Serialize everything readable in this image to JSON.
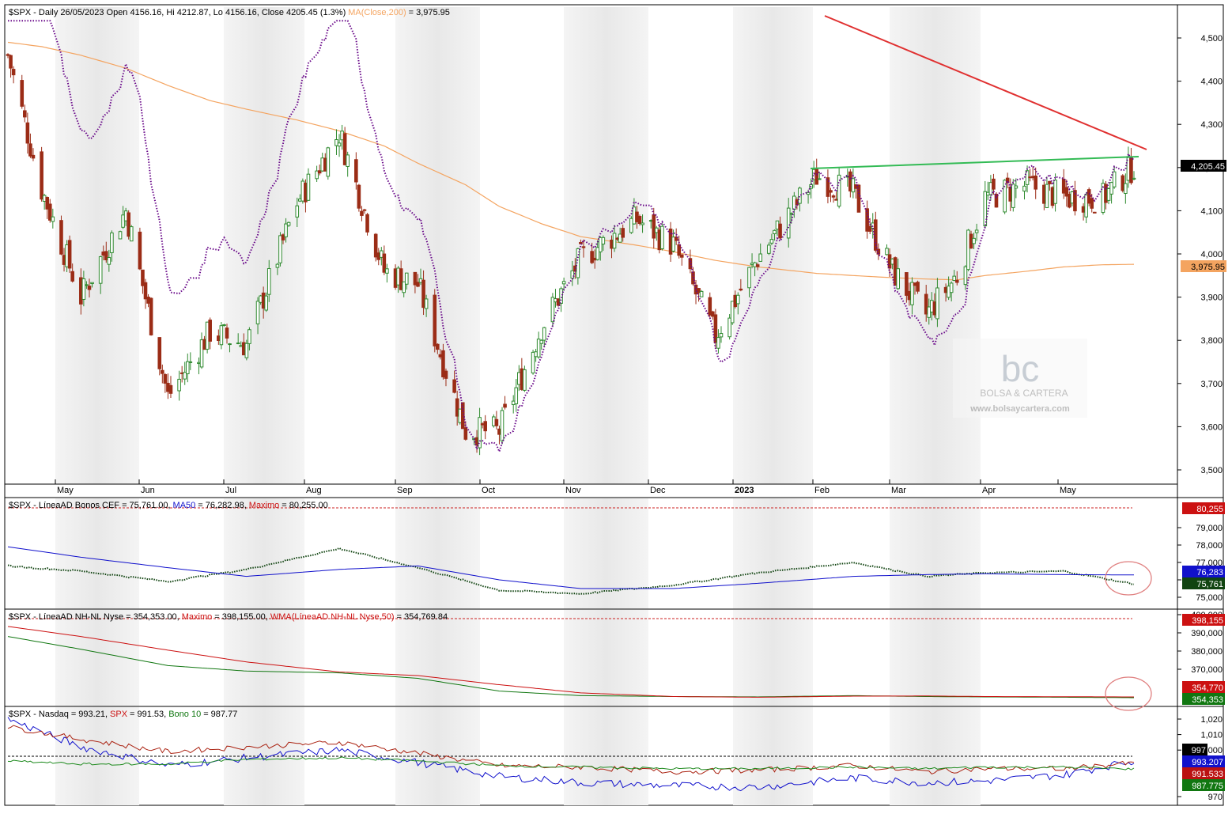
{
  "panel1": {
    "header": {
      "main": "$SPX - Daily 26/05/2023 Open 4156.16, Hi 4212.87, Lo 4156.16, Close 4205.45 (1.3%)",
      "ma_label": "MA(Close,200)",
      "ma_value": "= 3,975.95"
    },
    "y_ticks": [
      "4,500",
      "4,400",
      "4,300",
      "4,200",
      "4,100",
      "4,000",
      "3,900",
      "3,800",
      "3,700",
      "3,600",
      "3,500"
    ],
    "price_badge": "4,205.45",
    "ma_badge": "3,975.95",
    "watermark": {
      "brand": "BOLSA & CARTERA",
      "url": "www.bolsaycartera.com"
    }
  },
  "x_labels": [
    "May",
    "Jun",
    "Jul",
    "Aug",
    "Sep",
    "Oct",
    "Nov",
    "Dec",
    "2023",
    "Feb",
    "Mar",
    "Apr",
    "May"
  ],
  "panel2": {
    "header": {
      "main": "$SPX - LíneaAD Bonos CEF = 75,761.00,",
      "ma_label": "MA50",
      "ma_value": "= 76,282.98,",
      "max_label": "Maximo",
      "max_value": "= 80,255.00"
    },
    "y_ticks": [
      "79,000",
      "78,000",
      "77,000",
      "76,000",
      "75,000"
    ],
    "badges": {
      "max": "80,255",
      "ma": "76,283",
      "line": "75,761"
    }
  },
  "panel3": {
    "header": {
      "main": "$SPX - LíneaAD NH-NL Nyse = 354,353.00,",
      "max_label": "Maximo",
      "max_value": "= 398,155.00,",
      "wma_label": "WMA(LíneaAD NH-NL Nyse,50)",
      "wma_value": "= 354,769.84"
    },
    "y_ticks": [
      "400,000",
      "390,000",
      "380,000",
      "370,000"
    ],
    "badges": {
      "max": "398,155",
      "wma": "354,770",
      "line": "354,353"
    }
  },
  "panel4": {
    "header": {
      "main": "$SPX - Nasdaq",
      "nasdaq_value": "= 993.21,",
      "spx_label": "SPX",
      "spx_value": "= 991.53,",
      "bond_label": "Bono 10",
      "bond_value": "= 987.77"
    },
    "y_ticks": [
      "1,020",
      "1,010",
      "1,000",
      "970"
    ],
    "badges": {
      "ref": "997",
      "nasdaq": "993.207",
      "spx": "991.533",
      "bond": "987.775"
    }
  },
  "colors": {
    "up": "#2f8a2f",
    "down": "#9b2c16",
    "ma200": "#f4a460",
    "purple": "#6a0a8a",
    "resistance": "#e03030",
    "support": "#33bb55",
    "blue": "#1010cc",
    "green_line": "#1d7a1d",
    "red_line": "#cc1111",
    "dark_green": "#114411"
  },
  "chart_data": [
    {
      "type": "candlestick",
      "title": "$SPX - Daily 26/05/2023 Open 4156.16, Hi 4212.87, Lo 4156.16, Close 4205.45 (1.3%)",
      "x": [
        "2022-04-20",
        "2022-05-02",
        "2022-05-16",
        "2022-06-01",
        "2022-06-16",
        "2022-07-01",
        "2022-07-14",
        "2022-08-01",
        "2022-08-16",
        "2022-09-01",
        "2022-09-13",
        "2022-09-30",
        "2022-10-12",
        "2022-10-27",
        "2022-11-10",
        "2022-11-30",
        "2022-12-13",
        "2022-12-28",
        "2023-01-12",
        "2023-02-02",
        "2023-02-15",
        "2023-03-01",
        "2023-03-13",
        "2023-03-24",
        "2023-04-03",
        "2023-04-18",
        "2023-05-01",
        "2023-05-15",
        "2023-05-26"
      ],
      "close": [
        4460,
        4150,
        3900,
        4100,
        3670,
        3820,
        3790,
        4120,
        4280,
        3960,
        3930,
        3590,
        3590,
        3830,
        3990,
        4080,
        4020,
        3810,
        3990,
        4180,
        4140,
        3960,
        3860,
        3950,
        4130,
        4160,
        4130,
        4130,
        4205
      ],
      "ylim": [
        3480,
        4580
      ],
      "series": [
        {
          "name": "MA(Close,200)",
          "values": [
            4490,
            4480,
            4460,
            4430,
            4390,
            4355,
            4335,
            4310,
            4285,
            4250,
            4210,
            4160,
            4110,
            4070,
            4040,
            4020,
            4005,
            3985,
            3970,
            3955,
            3950,
            3945,
            3942,
            3940,
            3950,
            3960,
            3970,
            3975,
            3976
          ]
        }
      ],
      "annotations": [
        "descending resistance line",
        "horizontal support line",
        "dotted overlay line"
      ]
    },
    {
      "type": "line",
      "title": "$SPX - LíneaAD Bonos CEF = 75,761.00, MA50 = 76,282.98, Maximo = 80,255.00",
      "x": [
        "2022-04-20",
        "2022-05-16",
        "2022-06-16",
        "2022-07-14",
        "2022-08-16",
        "2022-09-13",
        "2022-10-12",
        "2022-11-10",
        "2022-12-13",
        "2023-01-12",
        "2023-02-15",
        "2023-03-13",
        "2023-04-03",
        "2023-05-01",
        "2023-05-26"
      ],
      "series": [
        {
          "name": "LíneaAD Bonos CEF",
          "values": [
            76800,
            76500,
            75900,
            76600,
            77800,
            76700,
            75400,
            75200,
            75700,
            76400,
            77000,
            76200,
            76400,
            76500,
            75761
          ]
        },
        {
          "name": "MA50",
          "values": [
            77900,
            77300,
            76700,
            76200,
            76600,
            76800,
            76000,
            75500,
            75500,
            75800,
            76200,
            76300,
            76350,
            76300,
            76283
          ]
        },
        {
          "name": "Maximo",
          "values": [
            80255,
            80255,
            80255,
            80255,
            80255,
            80255,
            80255,
            80255,
            80255,
            80255,
            80255,
            80255,
            80255,
            80255,
            80255
          ]
        }
      ],
      "ylim": [
        74700,
        80700
      ]
    },
    {
      "type": "line",
      "title": "$SPX - LíneaAD NH-NL Nyse = 354,353.00, Maximo = 398,155.00, WMA(LíneaAD NH-NL Nyse,50) = 354,769.84",
      "x": [
        "2022-04-20",
        "2022-05-16",
        "2022-06-16",
        "2022-07-14",
        "2022-08-16",
        "2022-09-13",
        "2022-10-12",
        "2022-11-10",
        "2022-12-13",
        "2023-01-12",
        "2023-02-15",
        "2023-03-13",
        "2023-04-03",
        "2023-05-01",
        "2023-05-26"
      ],
      "series": [
        {
          "name": "LíneaAD NH-NL Nyse",
          "values": [
            388000,
            381000,
            372000,
            369000,
            368000,
            365000,
            358000,
            355500,
            355000,
            354800,
            355500,
            355000,
            354800,
            354600,
            354353
          ]
        },
        {
          "name": "WMA(LíneaAD NH-NL Nyse,50)",
          "values": [
            393500,
            388000,
            380500,
            374000,
            368500,
            366500,
            361500,
            357000,
            355000,
            354600,
            355200,
            355300,
            355000,
            354900,
            354770
          ]
        },
        {
          "name": "Maximo",
          "values": [
            398155,
            398155,
            398155,
            398155,
            398155,
            398155,
            398155,
            398155,
            398155,
            398155,
            398155,
            398155,
            398155,
            398155,
            398155
          ]
        }
      ],
      "ylim": [
        348000,
        402000
      ]
    },
    {
      "type": "line",
      "title": "$SPX - Nasdaq = 993.21, SPX = 991.53, Bono 10 = 987.77",
      "x": [
        "2022-04-20",
        "2022-05-16",
        "2022-06-16",
        "2022-07-14",
        "2022-08-16",
        "2022-09-13",
        "2022-10-12",
        "2022-11-10",
        "2022-12-13",
        "2023-01-12",
        "2023-02-15",
        "2023-03-13",
        "2023-04-03",
        "2023-05-01",
        "2023-05-26"
      ],
      "series": [
        {
          "name": "Nasdaq",
          "values": [
            1020,
            1002,
            990,
            995,
            1000,
            992,
            983,
            979,
            977,
            976,
            982,
            979,
            980,
            984,
            993
          ]
        },
        {
          "name": "SPX",
          "values": [
            1015,
            1007,
            999,
            1002,
            1005,
            998,
            990,
            989,
            986,
            987,
            990,
            986,
            988,
            988,
            991.5
          ]
        },
        {
          "name": "Bono 10",
          "values": [
            993,
            991,
            991,
            994,
            995,
            993,
            990,
            989,
            988,
            988,
            989,
            988,
            989,
            989,
            987.8
          ]
        }
      ],
      "reference": 997,
      "ylim": [
        968,
        1024
      ]
    }
  ]
}
